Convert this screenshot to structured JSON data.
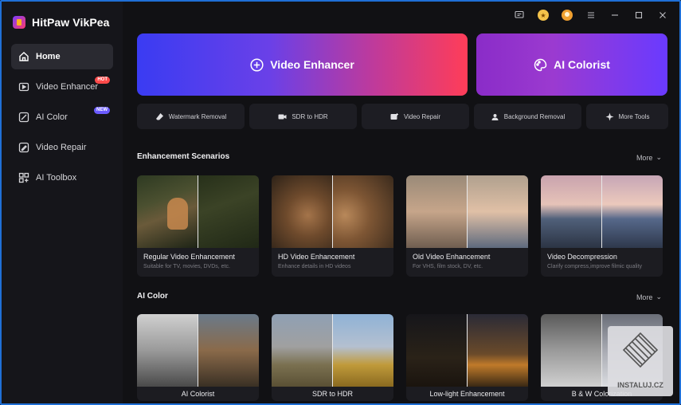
{
  "app": {
    "title": "HitPaw VikPea"
  },
  "sidebar": {
    "items": [
      {
        "label": "Home",
        "icon": "home-icon"
      },
      {
        "label": "Video Enhancer",
        "icon": "video-enhancer-icon",
        "badge": "HOT"
      },
      {
        "label": "AI Color",
        "icon": "ai-color-icon",
        "badge": "NEW"
      },
      {
        "label": "Video Repair",
        "icon": "video-repair-icon"
      },
      {
        "label": "AI Toolbox",
        "icon": "toolbox-icon"
      }
    ]
  },
  "hero": {
    "enhancer_label": "Video Enhancer",
    "colorist_label": "AI Colorist"
  },
  "tools": [
    {
      "label": "Watermark Removal",
      "icon": "eraser-icon"
    },
    {
      "label": "SDR to HDR",
      "icon": "camera-icon"
    },
    {
      "label": "Video Repair",
      "icon": "video-repair-icon"
    },
    {
      "label": "Background Removal",
      "icon": "person-bg-icon"
    },
    {
      "label": "More Tools",
      "icon": "sparkle-icon"
    }
  ],
  "enhancement": {
    "title": "Enhancement Scenarios",
    "more": "More",
    "cards": [
      {
        "title": "Regular Video Enhancement",
        "desc": "Suitable for TV, movies, DVDs, etc."
      },
      {
        "title": "HD Video Enhancement",
        "desc": "Enhance details in HD videos"
      },
      {
        "title": "Old Video Enhancement",
        "desc": "For VHS, film stock, DV, etc."
      },
      {
        "title": "Video Decompression",
        "desc": "Clarify compress,improve filmic quality"
      }
    ]
  },
  "ai_color": {
    "title": "AI Color",
    "more": "More",
    "cards": [
      {
        "title": "AI Colorist"
      },
      {
        "title": "SDR to HDR"
      },
      {
        "title": "Low-light Enhancement"
      },
      {
        "title": "B & W Colorization"
      }
    ]
  },
  "watermark": {
    "text": "INSTALUJ.CZ"
  },
  "colors": {
    "accent": "#1f6fd6",
    "hot": "#ff4a4a",
    "new": "#6b5bff"
  }
}
